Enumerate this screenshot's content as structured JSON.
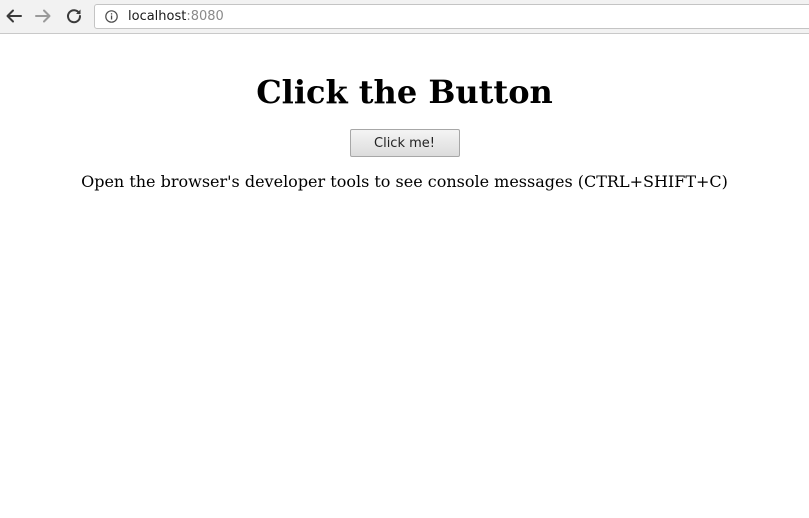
{
  "browser": {
    "url_host": "localhost",
    "url_port": ":8080",
    "icons": {
      "back": "arrow-left-icon",
      "forward": "arrow-right-icon",
      "reload": "reload-icon",
      "site_info": "info-icon"
    }
  },
  "page": {
    "title": "Click the Button",
    "button_label": "Click me!",
    "hint": "Open the browser's developer tools to see console messages (CTRL+SHIFT+C)"
  },
  "colors": {
    "toolbar_bg": "#f2f2f2",
    "port_text": "#8a8a8a"
  }
}
